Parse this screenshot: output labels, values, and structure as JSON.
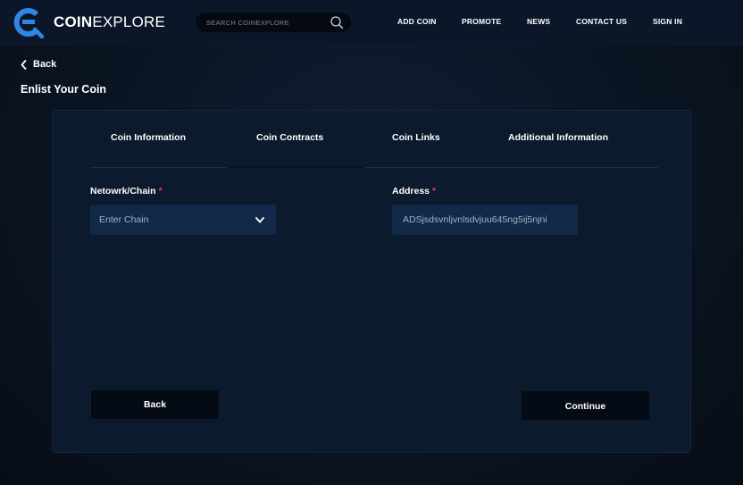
{
  "header": {
    "logo_bold": "COIN",
    "logo_light": "EXPLORE",
    "search_placeholder": "SEARCH COINEXPLORE",
    "nav": [
      "ADD COIN",
      "PROMOTE",
      "NEWS",
      "CONTACT US",
      "SIGN IN"
    ]
  },
  "back_label": "Back",
  "page_title": "Enlist Your Coin",
  "tabs": [
    "Coin Information",
    "Coin Contracts",
    "Coin Links",
    "Additional Information"
  ],
  "active_tab": "Coin Contracts",
  "form": {
    "network_label": "Netowrk/Chain",
    "network_required": "*",
    "network_value": "Enter Chain",
    "address_label": "Address",
    "address_required": "*",
    "address_value": "ADSjsdsvnljvnlsdvjuu645ng5ij5njni"
  },
  "buttons": {
    "back": "Back",
    "continue": "Continue"
  },
  "colors": {
    "background": "#0b1524",
    "card": "#0b1a2d",
    "input": "#12294a",
    "accent_logo": "#2f86e6",
    "required": "#e0434a"
  },
  "icons": [
    "logo-icon",
    "search-icon",
    "chevron-left-icon",
    "chevron-down-icon"
  ]
}
